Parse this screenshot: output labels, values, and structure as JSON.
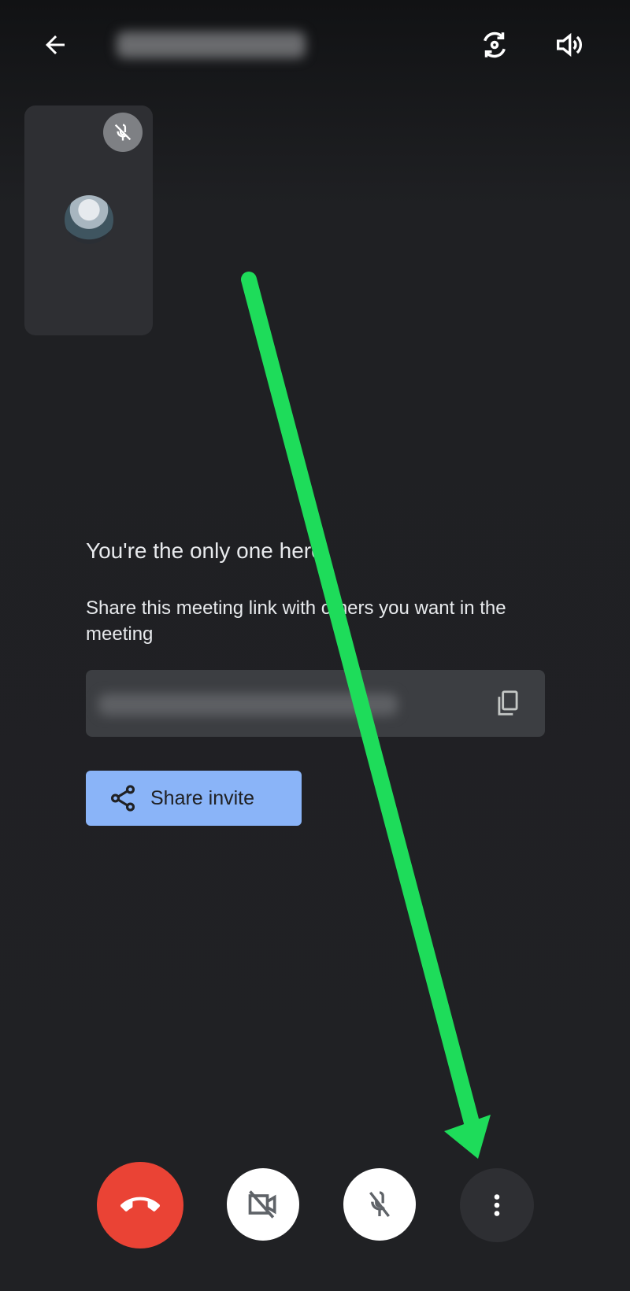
{
  "header": {
    "back_icon": "arrow-left-icon",
    "meeting_title": "",
    "switch_camera_icon": "camera-switch-icon",
    "audio_icon": "speaker-icon"
  },
  "self_tile": {
    "muted_icon": "mic-off-icon",
    "avatar": "avatar"
  },
  "main": {
    "heading": "You're the only one here",
    "description": "Share this meeting link with others you want in the meeting",
    "meeting_link": "",
    "copy_icon": "copy-icon",
    "share_button": {
      "icon": "share-icon",
      "label": "Share invite"
    }
  },
  "controls": [
    {
      "name": "end-call",
      "icon": "call-end-icon",
      "color": "#ea4335"
    },
    {
      "name": "camera-off",
      "icon": "videocam-off-icon",
      "color": "#ffffff"
    },
    {
      "name": "mic-off",
      "icon": "mic-off-icon",
      "color": "#ffffff"
    },
    {
      "name": "more-options",
      "icon": "more-vert-icon",
      "color": "#2e2f33"
    }
  ],
  "annotation": {
    "arrow_color": "#1edc5a"
  },
  "colors": {
    "background": "#202124",
    "accent": "#8ab4f8"
  }
}
